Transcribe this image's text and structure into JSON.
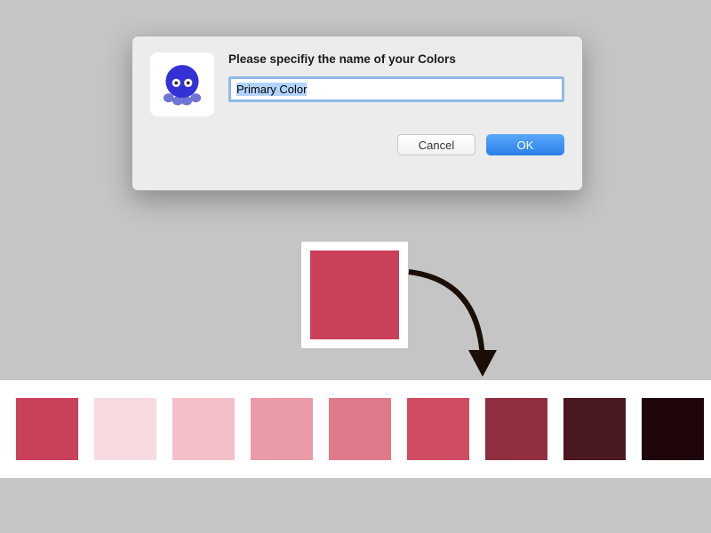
{
  "dialog": {
    "title": "Please specifiy the name of your Colors",
    "input_value": "Primary Color",
    "cancel_label": "Cancel",
    "ok_label": "OK",
    "icon_name": "octopus-icon"
  },
  "center_swatch": {
    "color": "#c9405a"
  },
  "palette": [
    {
      "color": "#c9405a"
    },
    {
      "color": "#f7dbe0"
    },
    {
      "color": "#f3c0c8"
    },
    {
      "color": "#ea9ba7"
    },
    {
      "color": "#df7a8a"
    },
    {
      "color": "#cf4c63"
    },
    {
      "color": "#8f2f3f"
    },
    {
      "color": "#4a1820"
    },
    {
      "color": "#1e060b"
    }
  ]
}
